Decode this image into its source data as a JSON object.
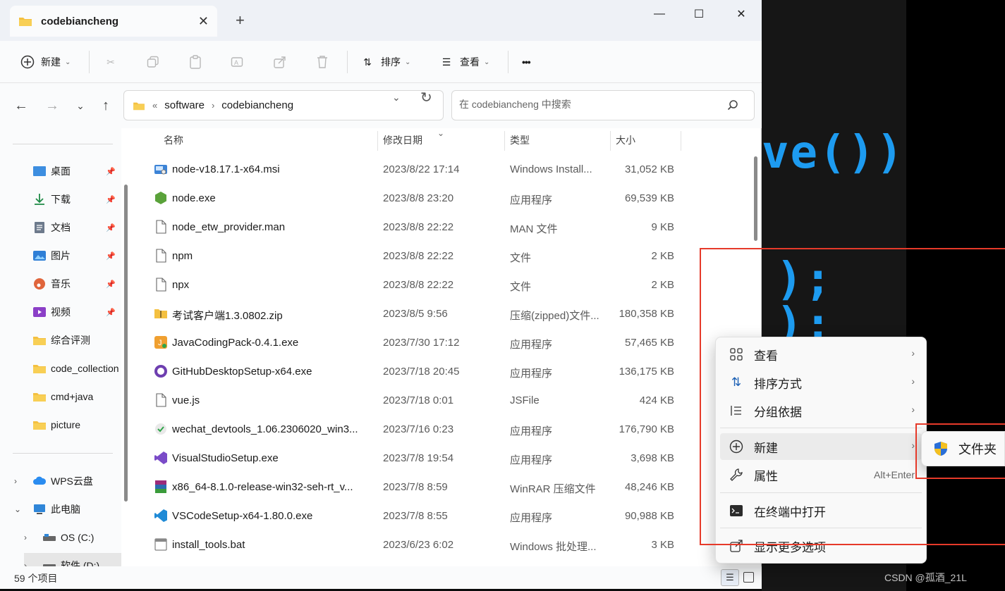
{
  "window": {
    "tab_title": "codebiancheng",
    "tab_close": "✕",
    "new_tab": "+",
    "minimize": "—",
    "maximize": "☐",
    "close": "✕"
  },
  "toolbar": {
    "new_label": "新建",
    "sort_label": "排序",
    "view_label": "查看",
    "more_label": "•••"
  },
  "nav": {
    "breadcrumb_prefix": "«",
    "crumbs": [
      "software",
      "codebiancheng"
    ],
    "search_placeholder": "在 codebiancheng 中搜索"
  },
  "sidebar": {
    "quick": [
      {
        "label": "桌面",
        "icon": "desktop-icon",
        "pinned": true
      },
      {
        "label": "下载",
        "icon": "download-icon",
        "pinned": true
      },
      {
        "label": "文档",
        "icon": "document-icon",
        "pinned": true
      },
      {
        "label": "图片",
        "icon": "picture-icon",
        "pinned": true
      },
      {
        "label": "音乐",
        "icon": "music-icon",
        "pinned": true
      },
      {
        "label": "视频",
        "icon": "video-icon",
        "pinned": true
      },
      {
        "label": "综合评测",
        "icon": "folder-icon",
        "pinned": false
      },
      {
        "label": "code_collection",
        "icon": "folder-icon",
        "pinned": false
      },
      {
        "label": "cmd+java",
        "icon": "folder-icon",
        "pinned": false
      },
      {
        "label": "picture",
        "icon": "folder-icon",
        "pinned": false
      }
    ],
    "pin_glyph": "📌",
    "wps": "WPS云盘",
    "this_pc": "此电脑",
    "os_c": "OS (C:)",
    "soft_d": "软件 (D:)"
  },
  "columns": {
    "name": "名称",
    "date": "修改日期",
    "type": "类型",
    "size": "大小"
  },
  "files": [
    {
      "name": "node-v18.17.1-x64.msi",
      "date": "2023/8/22 17:14",
      "type": "Windows Install...",
      "size": "31,052 KB",
      "icon": "msi-icon"
    },
    {
      "name": "node.exe",
      "date": "2023/8/8 23:20",
      "type": "应用程序",
      "size": "69,539 KB",
      "icon": "node-icon"
    },
    {
      "name": "node_etw_provider.man",
      "date": "2023/8/8 22:22",
      "type": "MAN 文件",
      "size": "9 KB",
      "icon": "file-icon"
    },
    {
      "name": "npm",
      "date": "2023/8/8 22:22",
      "type": "文件",
      "size": "2 KB",
      "icon": "file-icon"
    },
    {
      "name": "npx",
      "date": "2023/8/8 22:22",
      "type": "文件",
      "size": "2 KB",
      "icon": "file-icon"
    },
    {
      "name": "考试客户端1.3.0802.zip",
      "date": "2023/8/5 9:56",
      "type": "压缩(zipped)文件...",
      "size": "180,358 KB",
      "icon": "zip-icon"
    },
    {
      "name": "JavaCodingPack-0.4.1.exe",
      "date": "2023/7/30 17:12",
      "type": "应用程序",
      "size": "57,465 KB",
      "icon": "java-icon"
    },
    {
      "name": "GitHubDesktopSetup-x64.exe",
      "date": "2023/7/18 20:45",
      "type": "应用程序",
      "size": "136,175 KB",
      "icon": "github-icon"
    },
    {
      "name": "vue.js",
      "date": "2023/7/18 0:01",
      "type": "JSFile",
      "size": "424 KB",
      "icon": "file-icon"
    },
    {
      "name": "wechat_devtools_1.06.2306020_win3...",
      "date": "2023/7/16 0:23",
      "type": "应用程序",
      "size": "176,790 KB",
      "icon": "wechat-icon"
    },
    {
      "name": "VisualStudioSetup.exe",
      "date": "2023/7/8 19:54",
      "type": "应用程序",
      "size": "3,698 KB",
      "icon": "visualstudio-icon"
    },
    {
      "name": "x86_64-8.1.0-release-win32-seh-rt_v...",
      "date": "2023/7/8 8:59",
      "type": "WinRAR 压缩文件",
      "size": "48,246 KB",
      "icon": "winrar-icon"
    },
    {
      "name": "VSCodeSetup-x64-1.80.0.exe",
      "date": "2023/7/8 8:55",
      "type": "应用程序",
      "size": "90,988 KB",
      "icon": "vscode-icon"
    },
    {
      "name": "install_tools.bat",
      "date": "2023/6/23 6:02",
      "type": "Windows 批处理...",
      "size": "3 KB",
      "icon": "bat-icon"
    }
  ],
  "status": {
    "count": "59 个项目"
  },
  "context_menu": {
    "view": "查看",
    "sort_by": "排序方式",
    "group_by": "分组依据",
    "new": "新建",
    "properties": "属性",
    "properties_accel": "Alt+Enter",
    "open_terminal": "在终端中打开",
    "more_options": "显示更多选项",
    "submenu_folder": "文件夹"
  },
  "editor": {
    "line1": "ve())",
    "line2": ");",
    "line3": ");"
  },
  "watermark": "CSDN @孤酒_21L",
  "colors": {
    "accent": "#0067c0",
    "highlight_box": "#e63a2a",
    "folder": "#f4c040"
  }
}
